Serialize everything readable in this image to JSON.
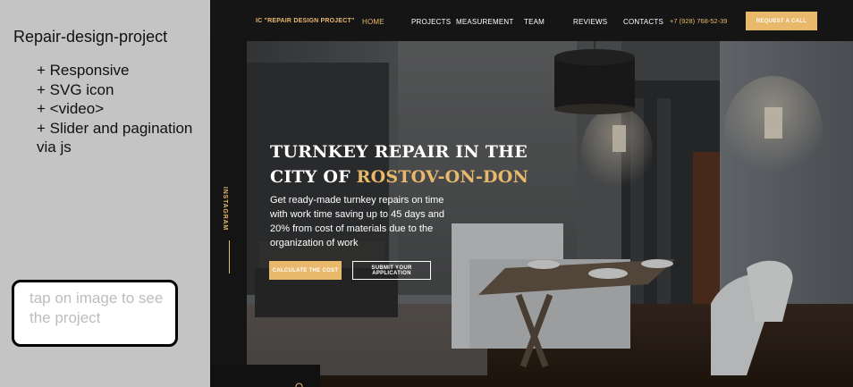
{
  "panel": {
    "title": "Repair-design-project",
    "features": [
      "+ Responsive",
      "+ SVG icon",
      "+ <video>",
      "+ Slider and pagination",
      "via js"
    ]
  },
  "note": {
    "text": "tap on image to see the project"
  },
  "site": {
    "brand": "IC \"REPAIR DESIGN PROJECT\"",
    "nav": [
      "HOME",
      "PROJECTS",
      "MEASUREMENT",
      "TEAM",
      "REVIEWS",
      "CONTACTS"
    ],
    "active_nav": "HOME",
    "phone": "+7 (928) 768-52-39",
    "call_button": "REQUEST A CALL",
    "sidebar_label": "INSTAGRAM",
    "headline": {
      "line1": "TURNKEY REPAIR IN THE",
      "line2_prefix": "CITY OF ",
      "line2_highlight": "ROSTOV-ON-DON"
    },
    "lead": "Get ready-made turnkey repairs on time with work time saving up to 45 days and 20% from cost of materials due to the organization of work",
    "buttons": {
      "calculate": "CALCULATE THE COST",
      "apply": "SUBMIT YOUR APPLICATION"
    },
    "icons": {
      "scroll": "scroll-down-icon"
    },
    "colors": {
      "accent": "#e8b86b",
      "topbar": "#151515",
      "sidebar": "#141414"
    }
  }
}
